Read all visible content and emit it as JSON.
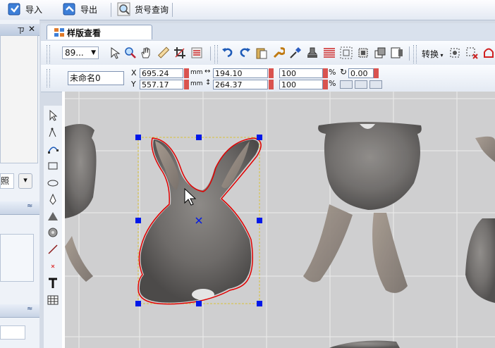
{
  "toolbar": {
    "import_label": "导入",
    "export_label": "导出",
    "sku_query_label": "货号查询"
  },
  "left_panel": {
    "pin_glyph": "ㄗ",
    "close_glyph": "✕",
    "photo_fragment": "照",
    "dropdown_glyph": "▾",
    "collapse_glyph": "≈"
  },
  "tab": {
    "title": "样版查看"
  },
  "toolrow1": {
    "zoom_value": "89...",
    "convert_label": "转换"
  },
  "properties": {
    "name_value": "未命名0",
    "x_label": "X",
    "y_label": "Y",
    "x_value": "695.24",
    "y_value": "557.17",
    "unit_mm": "mm",
    "width_value": "194.10",
    "height_value": "264.37",
    "scale_w_value": "100",
    "scale_h_value": "100",
    "percent": "%",
    "rotation_value": "0.00"
  },
  "colors": {
    "selection_handle": "#0018e8",
    "outline_red": "#e00000",
    "bbox_yellow": "#d8c23a"
  }
}
